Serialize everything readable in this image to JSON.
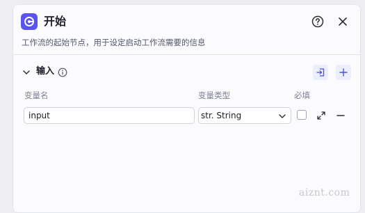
{
  "header": {
    "title": "开始",
    "description": "工作流的起始节点，用于设定启动工作流需要的信息",
    "icons": {
      "node": "start-node-icon",
      "help": "help-circle-icon",
      "close": "close-icon"
    }
  },
  "inputs_section": {
    "title": "输入",
    "columns": {
      "name": "变量名",
      "type": "变量类型",
      "required": "必填"
    },
    "rows": [
      {
        "name": "input",
        "type": "str. String",
        "required": false
      }
    ],
    "icons": {
      "toggle": "chevron-down-icon",
      "info": "info-icon",
      "import": "import-icon",
      "add": "plus-icon",
      "expand": "expand-icon",
      "remove": "minus-icon"
    }
  },
  "colors": {
    "accent": "#5a52f4",
    "button_bg": "#ebeefc",
    "panel_bg": "#fbfbfd"
  },
  "watermark": "aiznt.com"
}
